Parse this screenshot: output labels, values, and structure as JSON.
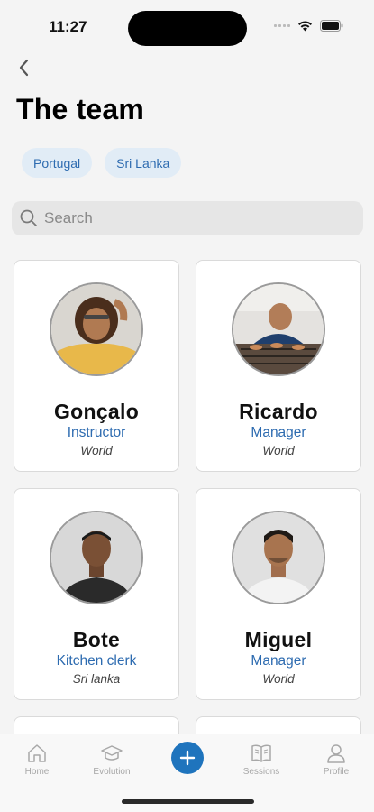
{
  "status_bar": {
    "time": "11:27"
  },
  "header": {
    "title": "The team"
  },
  "filters": [
    {
      "label": "Portugal"
    },
    {
      "label": "Sri Lanka"
    }
  ],
  "search": {
    "placeholder": "Search"
  },
  "team": [
    {
      "name": "Gonçalo",
      "role": "Instructor",
      "location": "World"
    },
    {
      "name": "Ricardo",
      "role": "Manager",
      "location": "World"
    },
    {
      "name": "Bote",
      "role": "Kitchen clerk",
      "location": "Sri lanka"
    },
    {
      "name": "Miguel",
      "role": "Manager",
      "location": "World"
    }
  ],
  "tab_bar": {
    "home": "Home",
    "evolution": "Evolution",
    "sessions": "Sessions",
    "profile": "Profile"
  },
  "colors": {
    "accent": "#2d6bb0",
    "chip_bg": "#e1ecf6",
    "add_button": "#1f74bd"
  },
  "icons": [
    "back-chevron-icon",
    "search-icon",
    "home-icon",
    "graduation-cap-icon",
    "plus-icon",
    "book-icon",
    "person-icon",
    "wifi-icon",
    "battery-icon",
    "signal-icon"
  ]
}
